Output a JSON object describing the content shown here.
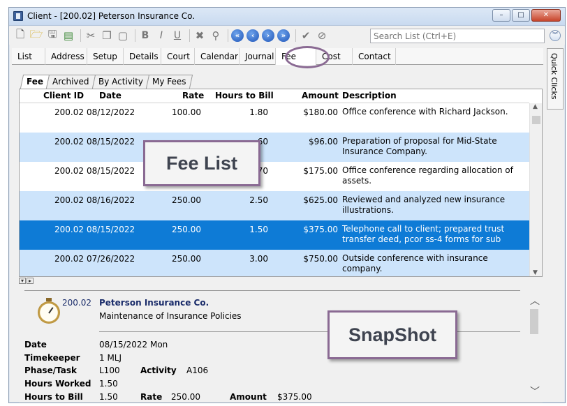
{
  "window": {
    "title": "Client - [200.02] Peterson Insurance Co.",
    "controls": {
      "minimize": "–",
      "maximize": "□",
      "close": "✕"
    }
  },
  "toolbar": {
    "icons": [
      "new-doc-icon",
      "open-folder-icon",
      "save-icon",
      "save-close-icon",
      "cut-icon",
      "copy-icon",
      "paste-icon",
      "bold-icon",
      "italic-icon",
      "underline-icon",
      "delete-icon",
      "spellcheck-icon",
      "first-record-icon",
      "previous-record-icon",
      "next-record-icon",
      "last-record-icon",
      "check-icon",
      "cancel-icon"
    ],
    "text_icons": {
      "bold": "B",
      "italic": "I",
      "underline": "U"
    },
    "search_placeholder": "Search List (Ctrl+E)",
    "collapse_icon": "chevron-double-down-icon"
  },
  "main_tabs": [
    "List",
    "Address",
    "Setup",
    "Details",
    "Court",
    "Calendar",
    "Journal",
    "Fee",
    "Cost",
    "Contact"
  ],
  "active_main_tab": "Fee",
  "quick_clicks_label": "Quick Clicks",
  "sub_tabs": [
    "Fee",
    "Archived",
    "By Activity",
    "My Fees"
  ],
  "active_sub_tab": "Fee",
  "fee_grid": {
    "columns": [
      "Client ID",
      "Date",
      "Rate",
      "Hours to Bill",
      "Amount",
      "Description"
    ],
    "rows": [
      {
        "client_id": "200.02",
        "date": "08/12/2022",
        "rate": "100.00",
        "hours": "1.80",
        "amount": "$180.00",
        "description": "Office conference with Richard Jackson."
      },
      {
        "client_id": "200.02",
        "date": "08/15/2022",
        "rate": "",
        "hours": "60",
        "amount": "$96.00",
        "description": "Preparation of proposal for Mid-State Insurance Company."
      },
      {
        "client_id": "200.02",
        "date": "08/15/2022",
        "rate": "",
        "hours": "70",
        "amount": "$175.00",
        "description": "Office conference regarding allocation of assets."
      },
      {
        "client_id": "200.02",
        "date": "08/16/2022",
        "rate": "250.00",
        "hours": "2.50",
        "amount": "$625.00",
        "description": "Reviewed and analyzed new insurance illustrations."
      },
      {
        "client_id": "200.02",
        "date": "08/15/2022",
        "rate": "250.00",
        "hours": "1.50",
        "amount": "$375.00",
        "description": "Telephone call to client; prepared trust transfer deed, pcor ss-4 forms for sub"
      },
      {
        "client_id": "200.02",
        "date": "07/26/2022",
        "rate": "250.00",
        "hours": "3.00",
        "amount": "$750.00",
        "description": "Outside conference with insurance company."
      }
    ],
    "selected_row_index": 4
  },
  "snapshot": {
    "client_id": "200.02",
    "client_name": "Peterson Insurance Co.",
    "matter": "Maintenance of Insurance Policies",
    "labels": {
      "date": "Date",
      "timekeeper": "Timekeeper",
      "phase_task": "Phase/Task",
      "activity": "Activity",
      "hours_worked": "Hours Worked",
      "hours_to_bill": "Hours to Bill",
      "rate": "Rate",
      "amount": "Amount"
    },
    "values": {
      "date": "08/15/2022  Mon",
      "timekeeper": "1  MLJ",
      "phase_task": "L100",
      "activity": "A106",
      "hours_worked": "1.50",
      "hours_to_bill": "1.50",
      "rate": "250.00",
      "amount": "$375.00"
    }
  },
  "callouts": {
    "fee_list": "Fee List",
    "snapshot": "SnapShot"
  },
  "colors": {
    "accent": "#8a6a93",
    "selected_row": "#0e7bd6",
    "alt_row": "#cde4fb"
  }
}
